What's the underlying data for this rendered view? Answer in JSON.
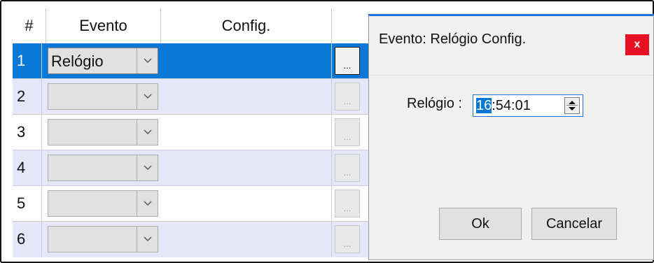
{
  "grid": {
    "headers": [
      "#",
      "Evento",
      "Config."
    ],
    "rows": [
      {
        "num": "1",
        "evento": "Relógio",
        "button": "..."
      },
      {
        "num": "2",
        "evento": "",
        "button": "..."
      },
      {
        "num": "3",
        "evento": "",
        "button": "..."
      },
      {
        "num": "4",
        "evento": "",
        "button": "..."
      },
      {
        "num": "5",
        "evento": "",
        "button": "..."
      },
      {
        "num": "6",
        "evento": "",
        "button": "..."
      }
    ],
    "selected_row": "1"
  },
  "dialog": {
    "title": "Evento: Relógio Config.",
    "close_label": "x",
    "field_label": "Relógio :",
    "time_selected": "16",
    "time_rest": ":54:01",
    "ok_label": "Ok",
    "cancel_label": "Cancelar"
  },
  "colors": {
    "selection": "#0a78d7",
    "alt_row": "#e6e6fa",
    "close": "#e81123"
  }
}
